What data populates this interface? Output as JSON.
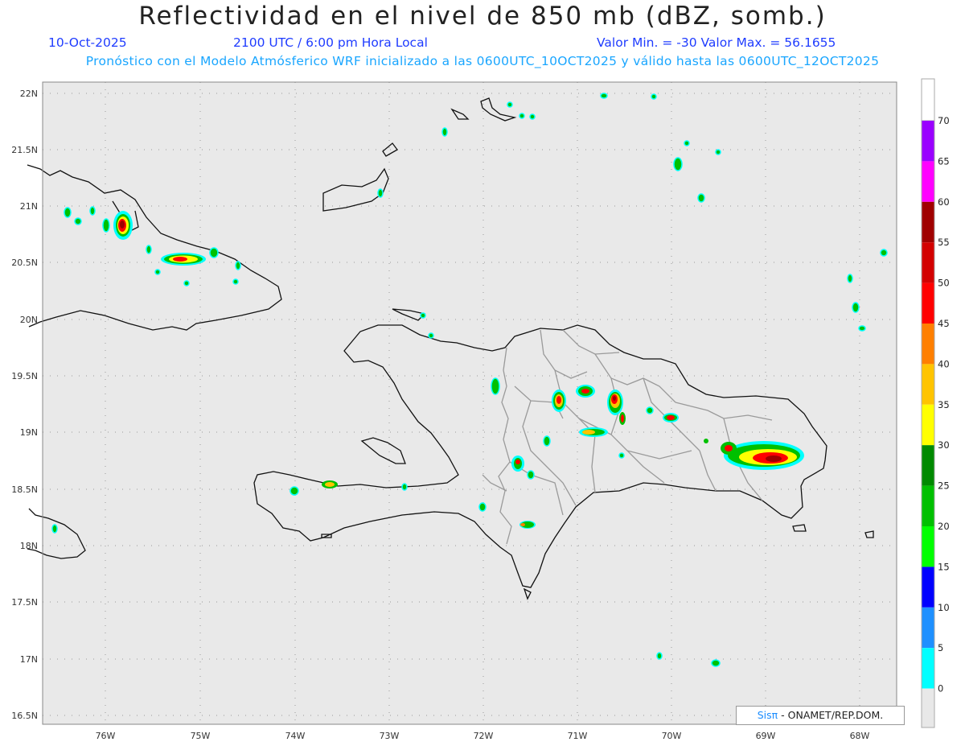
{
  "header": {
    "title": "Reflectividad en el nivel de 850 mb (dBZ, somb.)",
    "date": "10-Oct-2025",
    "time": "2100 UTC / 6:00 pm Hora Local",
    "minmax": "Valor Min. = -30  Valor Max. = 56.1655",
    "model_info": "Pronóstico con el Modelo Atmósferico WRF inicializado a las 0600UTC_10OCT2025 y válido hasta las  0600UTC_12OCT2025"
  },
  "axes": {
    "lat_labels": [
      "22N",
      "21.5N",
      "21N",
      "20.5N",
      "20N",
      "19.5N",
      "19N",
      "18.5N",
      "18N",
      "17.5N",
      "17N",
      "16.5N"
    ],
    "lon_labels": [
      "76W",
      "75W",
      "74W",
      "73W",
      "72W",
      "71W",
      "70W",
      "69W",
      "68W"
    ]
  },
  "colorbar": {
    "labels": [
      "70",
      "65",
      "60",
      "55",
      "50",
      "45",
      "40",
      "35",
      "30",
      "25",
      "20",
      "15",
      "10",
      "5",
      "0"
    ],
    "colors": [
      "#9a00ff",
      "#ff00ff",
      "#a00000",
      "#d30000",
      "#ff0000",
      "#ff7f00",
      "#ffc400",
      "#ffff00",
      "#008a00",
      "#00c000",
      "#00ff00",
      "#0000ff",
      "#1e90ff",
      "#00ffff",
      "#e8e8e8"
    ]
  },
  "credit": {
    "sis": "Sisπ",
    "org": " - ONAMET/REP.DOM."
  }
}
